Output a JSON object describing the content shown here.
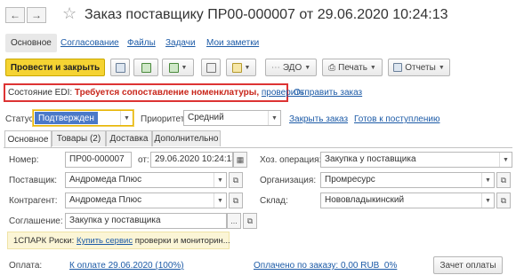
{
  "header": {
    "back_icon": "arrow-left",
    "forward_icon": "arrow-right",
    "star_icon": "star-outline",
    "title": "Заказ поставщику ПР00-000007 от 29.06.2020 10:24:13"
  },
  "sections": [
    "Основное",
    "Согласование",
    "Файлы",
    "Задачи",
    "Мои заметки"
  ],
  "toolbar": {
    "post_close": "Провести и закрыть",
    "edo": "ЭДО",
    "print": "Печать",
    "reports": "Отчеты"
  },
  "edi": {
    "label": "Состояние EDI:",
    "status": "Требуется сопоставление номенклатуры,",
    "check_link": "проверить",
    "send_link": "Отправить заказ"
  },
  "status_row": {
    "status_label": "Статус:",
    "status_value": "Подтвержден",
    "priority_label": "Приоритет:",
    "priority_value": "Средний",
    "close_link": "Закрыть заказ",
    "ready_link": "Готов к поступлению"
  },
  "tabs": [
    "Основное",
    "Товары (2)",
    "Доставка",
    "Дополнительно"
  ],
  "form": {
    "number_label": "Номер:",
    "number_value": "ПР00-000007",
    "date_label": "от:",
    "date_value": "29.06.2020 10:24:13",
    "operation_label": "Хоз. операция:",
    "operation_value": "Закупка у поставщика",
    "supplier_label": "Поставщик:",
    "supplier_value": "Андромеда Плюс",
    "org_label": "Организация:",
    "org_value": "Промресурс",
    "counterparty_label": "Контрагент:",
    "counterparty_value": "Андромеда Плюс",
    "warehouse_label": "Склад:",
    "warehouse_value": "Нововладыкинский",
    "agreement_label": "Соглашение:",
    "agreement_value": "Закупка у поставщика"
  },
  "spark": {
    "prefix": "1СПАРК Риски:",
    "link": "Купить сервис",
    "text": "проверки и мониторин..."
  },
  "payment": {
    "label": "Оплата:",
    "to_pay_link": "К оплате 29.06.2020 (100%)",
    "paid_link": "Оплачено по заказу: 0,00 RUB  0%",
    "offset_button": "Зачет оплаты"
  }
}
